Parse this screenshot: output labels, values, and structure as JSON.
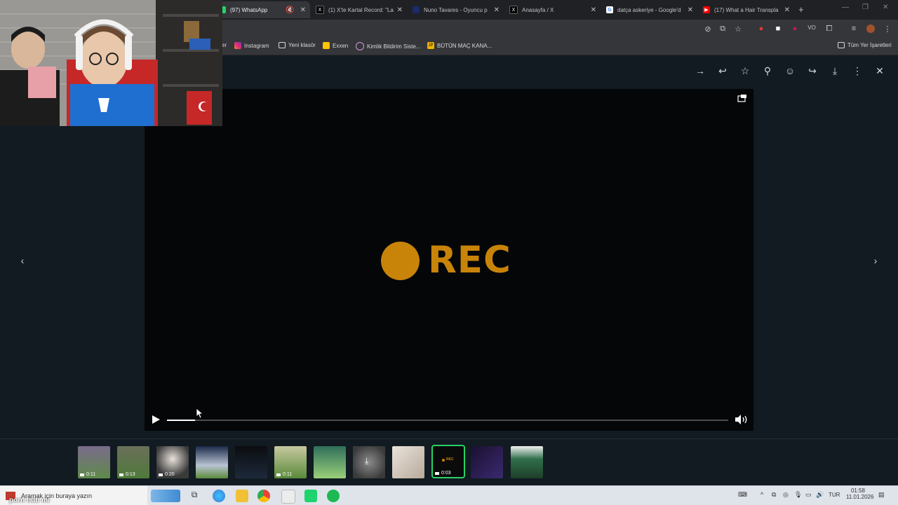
{
  "tabs": [
    {
      "title": "(97) WhatsApp",
      "favicon": "whatsapp-icon",
      "active": true,
      "muted": true
    },
    {
      "title": "(1) X'te Kartal Record: \"La",
      "favicon": "x-icon"
    },
    {
      "title": "Nuno Tavares - Oyuncu p",
      "favicon": "site-icon"
    },
    {
      "title": "Anasayfa / X",
      "favicon": "x-icon"
    },
    {
      "title": "datça askeriye - Google'd",
      "favicon": "google-icon"
    },
    {
      "title": "(17) What a Hair Transpla",
      "favicon": "youtube-icon"
    }
  ],
  "bookmarks": [
    {
      "label": "Instagram",
      "icon": "instagram-icon"
    },
    {
      "label": "Yeni klasör",
      "icon": "folder-icon"
    },
    {
      "label": "Exxen",
      "icon": "exxen-icon"
    },
    {
      "label": "Kimlik Bildirim Siste...",
      "icon": "link-icon"
    },
    {
      "label": "BÜTÜN MAÇ KANA...",
      "icon": "jp-icon"
    }
  ],
  "bookmarks_partial_label": "er",
  "all_bookmarks_label": "Tüm Yer İşaretleri",
  "viewer": {
    "video_logo_text": "REC",
    "progress_fraction": 0.05,
    "accent_color": "#c88409",
    "thumbnails": [
      {
        "duration": "0:11",
        "video": true
      },
      {
        "duration": "0:13",
        "video": true
      },
      {
        "duration": "0:20",
        "video": true
      },
      {
        "duration": "",
        "video": false
      },
      {
        "duration": "",
        "video": false
      },
      {
        "duration": "0:11",
        "video": true
      },
      {
        "duration": "",
        "video": false
      },
      {
        "duration": "",
        "video": false
      },
      {
        "duration": "",
        "video": false
      },
      {
        "duration": "0:03",
        "video": true,
        "selected": true
      },
      {
        "duration": "",
        "video": false
      },
      {
        "duration": "",
        "video": false
      }
    ]
  },
  "taskbar": {
    "search_placeholder": "Aramak için buraya yazın",
    "overlay_text": "porn hub mı",
    "language": "TUR",
    "time": "01:58",
    "date": "11.01.2026"
  }
}
